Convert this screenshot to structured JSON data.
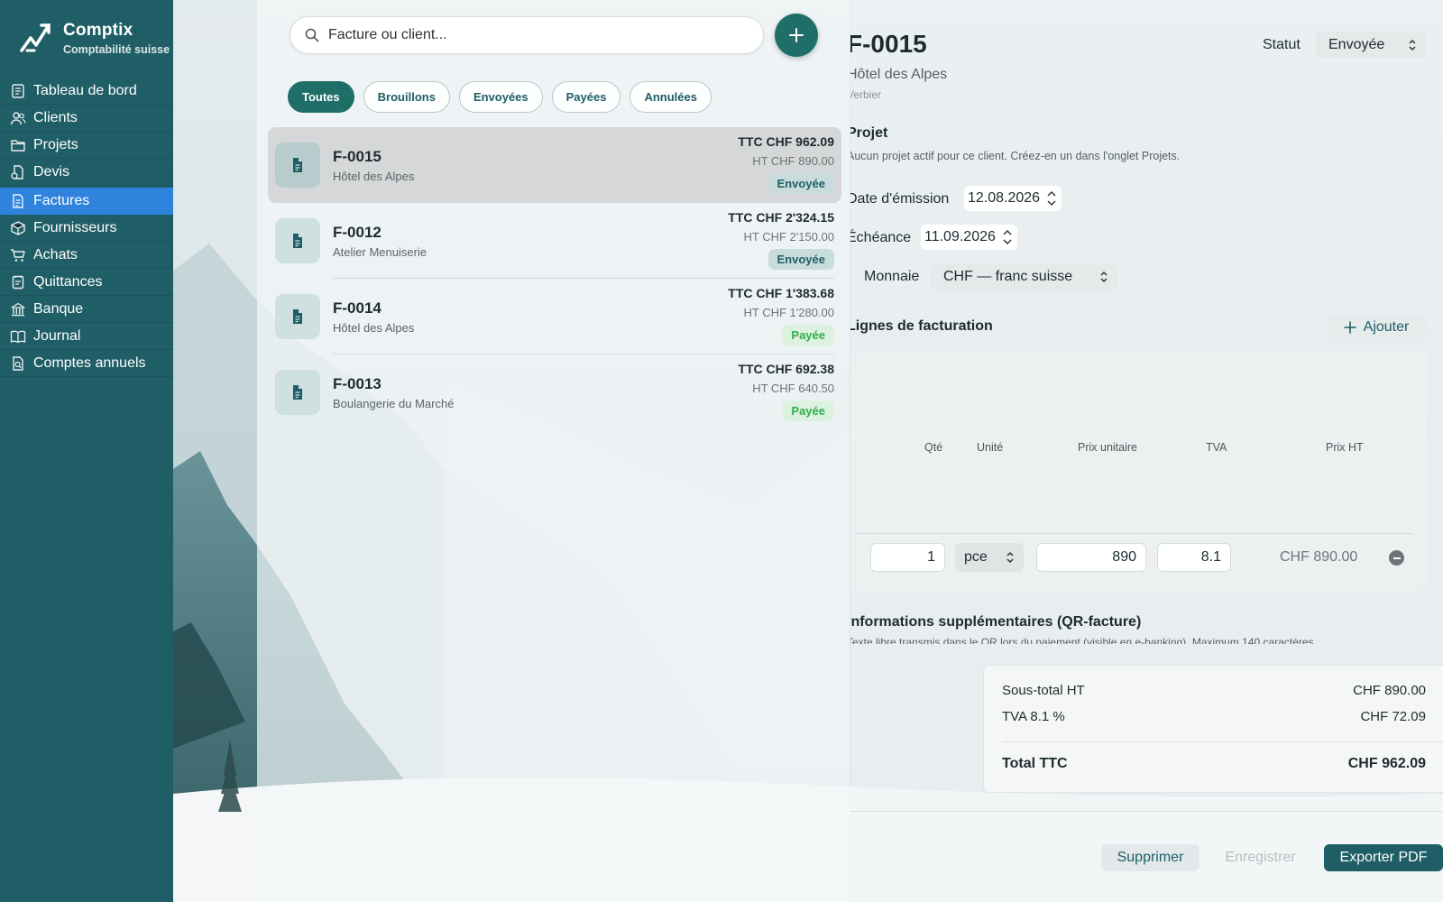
{
  "sidebar": {
    "brand_name": "Comptix",
    "brand_sub": "Comptabilité suisse",
    "items": [
      {
        "label": "Tableau de bord",
        "icon": "dashboard-icon"
      },
      {
        "label": "Clients",
        "icon": "users-icon"
      },
      {
        "label": "Projets",
        "icon": "folder-icon"
      },
      {
        "label": "Devis",
        "icon": "quote-icon"
      },
      {
        "label": "Factures",
        "icon": "invoice-icon",
        "active": true
      },
      {
        "label": "Fournisseurs",
        "icon": "box-icon"
      },
      {
        "label": "Achats",
        "icon": "cart-icon"
      },
      {
        "label": "Quittances",
        "icon": "receipt-icon"
      },
      {
        "label": "Banque",
        "icon": "bank-icon"
      },
      {
        "label": "Journal",
        "icon": "book-icon"
      },
      {
        "label": "Comptes annuels",
        "icon": "report-icon"
      }
    ]
  },
  "list": {
    "search_placeholder": "Facture ou client...",
    "filters": [
      "Toutes",
      "Brouillons",
      "Envoyées",
      "Payées",
      "Annulées"
    ],
    "active_filter": "Toutes",
    "invoices": [
      {
        "id": "F-0015",
        "client": "Hôtel des Alpes",
        "ttc": "TTC CHF 962.09",
        "ht": "HT CHF 890.00",
        "status": "Envoyée",
        "status_type": "sent",
        "selected": true
      },
      {
        "id": "F-0012",
        "client": "Atelier Menuiserie",
        "ttc": "TTC CHF 2'324.15",
        "ht": "HT CHF 2'150.00",
        "status": "Envoyée",
        "status_type": "sent"
      },
      {
        "id": "F-0014",
        "client": "Hôtel des Alpes",
        "ttc": "TTC CHF 1'383.68",
        "ht": "HT CHF 1'280.00",
        "status": "Payée",
        "status_type": "paid"
      },
      {
        "id": "F-0013",
        "client": "Boulangerie du Marché",
        "ttc": "TTC CHF 692.38",
        "ht": "HT CHF 640.50",
        "status": "Payée",
        "status_type": "paid"
      }
    ]
  },
  "detail": {
    "title": "F-0015",
    "client": "Hôtel des Alpes",
    "city": "Verbier",
    "status_label": "Statut",
    "status_value": "Envoyée",
    "project_heading": "Projet",
    "project_note": "Aucun projet actif pour ce client. Créez-en un dans l'onglet Projets.",
    "issue_label": "Date d'émission",
    "issue_date": "12.08.2026",
    "due_label": "Échéance",
    "due_date": "11.09.2026",
    "currency_label": "Monnaie",
    "currency_value": "CHF — franc suisse",
    "lines_heading": "Lignes de facturation",
    "add_label": "Ajouter",
    "columns": {
      "qty": "Qté",
      "unit": "Unité",
      "unit_price": "Prix unitaire",
      "vat": "TVA",
      "net": "Prix HT"
    },
    "line": {
      "qty": "1",
      "unit": "pce",
      "unit_price": "890",
      "vat": "8.1",
      "net": "CHF 890.00"
    },
    "info_heading": "Informations supplémentaires (QR-facture)",
    "info_note": "Texte libre transmis dans le QR lors du paiement (visible en e-banking). Maximum 140 caractères.",
    "subtotal_label": "Sous-total HT",
    "subtotal_value": "CHF 890.00",
    "vat_label": "TVA 8.1 %",
    "vat_value": "CHF 72.09",
    "total_label": "Total TTC",
    "total_value": "CHF 962.09",
    "delete_label": "Supprimer",
    "save_label": "Enregistrer",
    "export_label": "Exporter PDF"
  },
  "colors": {
    "sidebar": "#1f5e66",
    "accent": "#1f6f68",
    "active_nav": "#2f83dd",
    "paid": "#2eae4e"
  }
}
